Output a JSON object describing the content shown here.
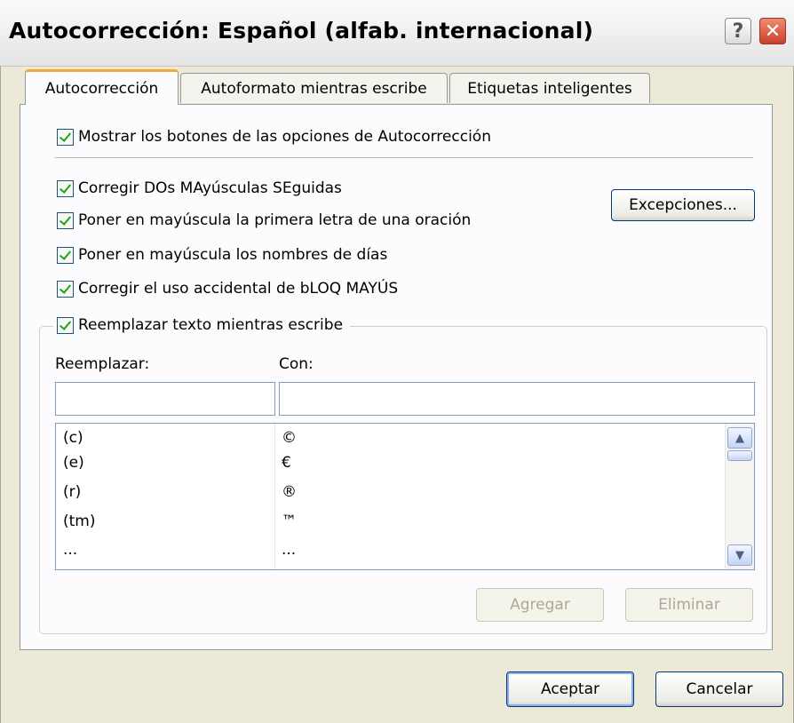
{
  "window": {
    "title": "Autocorrección: Español (alfab. internacional)",
    "help_glyph": "?",
    "close_glyph": "✕"
  },
  "tabs": [
    {
      "label": "Autocorrección",
      "active": true
    },
    {
      "label": "Autoformato mientras escribe",
      "active": false
    },
    {
      "label": "Etiquetas inteligentes",
      "active": false
    }
  ],
  "options": {
    "show_buttons": {
      "label": "Mostrar los botones de las opciones de Autocorrección",
      "checked": true
    },
    "two_initial_caps": {
      "label": "Corregir DOs MAyúsculas SEguidas",
      "checked": true
    },
    "capitalize_sentence": {
      "label": "Poner en mayúscula la primera letra de una oración",
      "checked": true
    },
    "capitalize_days": {
      "label": "Poner en mayúscula los nombres de días",
      "checked": true
    },
    "caps_lock": {
      "label": "Corregir el uso accidental de bLOQ MAYÚS",
      "checked": true
    },
    "replace_text": {
      "label": "Reemplazar texto mientras escribe",
      "checked": true
    }
  },
  "exceptions_button": "Excepciones...",
  "replace": {
    "replace_label": "Reemplazar:",
    "with_label": "Con:",
    "replace_value": "",
    "with_value": ""
  },
  "entries": [
    {
      "from": "(c)",
      "to": "©"
    },
    {
      "from": "(e)",
      "to": "€"
    },
    {
      "from": "(r)",
      "to": "®"
    },
    {
      "from": "(tm)",
      "to": "™"
    },
    {
      "from": "...",
      "to": "..."
    }
  ],
  "list_buttons": {
    "add": "Agregar",
    "remove": "Eliminar"
  },
  "dialog_buttons": {
    "ok": "Aceptar",
    "cancel": "Cancelar"
  },
  "colors": {
    "active_tab_accent": "#f2a93b",
    "check": "#21a121",
    "close_button": "#c7412a"
  }
}
